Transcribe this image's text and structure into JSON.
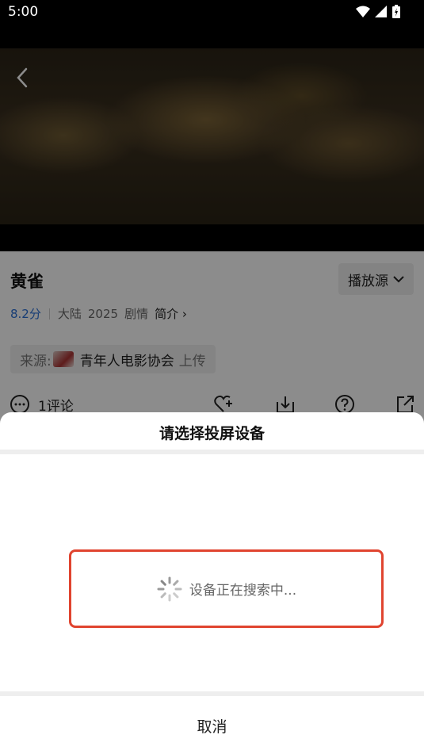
{
  "status_bar": {
    "time": "5:00"
  },
  "movie": {
    "title": "黄雀",
    "score": "8.2分",
    "region": "大陆",
    "year": "2025",
    "genre": "剧情",
    "intro_label": "简介",
    "source_button": "播放源",
    "source_label": "来源:",
    "uploader": "青年人电影协会",
    "upload_suffix": "上传",
    "comment_count": "1评论"
  },
  "cast_sheet": {
    "title": "请选择投屏设备",
    "searching_text": "设备正在搜索中...",
    "cancel_label": "取消"
  },
  "colors": {
    "accent_blue": "#2a6fd6",
    "highlight_red": "#e0442f"
  }
}
